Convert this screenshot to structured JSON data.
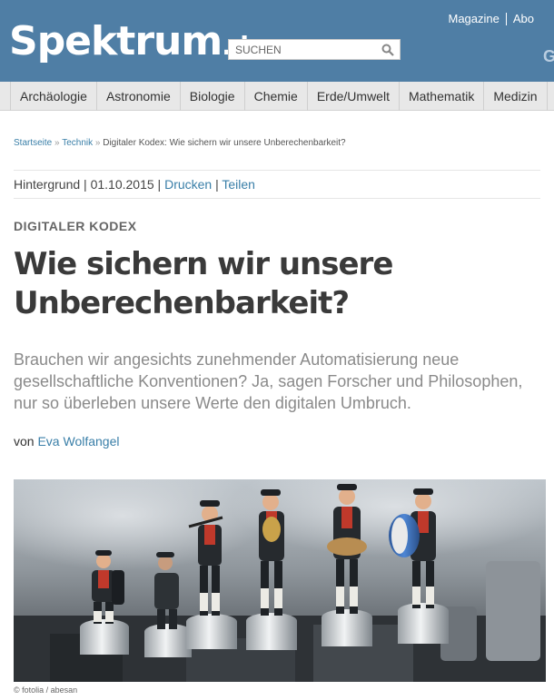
{
  "header": {
    "logo_main": "Spektrum",
    "logo_tld": ".de",
    "search_placeholder": "SUCHEN",
    "top_links": [
      "Magazine",
      "Abo"
    ],
    "edge_char": "G",
    "colors": {
      "header_bg": "#4f7ea5",
      "link": "#3a7fa8",
      "nav_bg": "#e8e8e8"
    }
  },
  "nav": {
    "items": [
      "Archäologie",
      "Astronomie",
      "Biologie",
      "Chemie",
      "Erde/Umwelt",
      "Mathematik",
      "Medizin"
    ]
  },
  "breadcrumb": {
    "home": "Startseite",
    "category": "Technik",
    "current": "Digitaler Kodex: Wie sichern wir unsere Unberechenbarkeit?",
    "separator": "»"
  },
  "meta": {
    "type": "Hintergrund",
    "date": "01.10.2015",
    "print": "Drucken",
    "share": "Teilen"
  },
  "article": {
    "kicker": "DIGITALER KODEX",
    "headline": "Wie sichern wir unsere Unberechenbarkeit?",
    "teaser": "Brauchen wir angesichts zunehmender Automatisierung neue gesellschaftliche Konventionen? Ja, sagen Forscher und Philosophen, nur so überleben unsere Werte den digitalen Umbruch.",
    "by_label": "von",
    "author": "Eva Wolfangel",
    "image_credit": "© fotolia / abesan"
  },
  "icons": {
    "search": "search-icon"
  }
}
